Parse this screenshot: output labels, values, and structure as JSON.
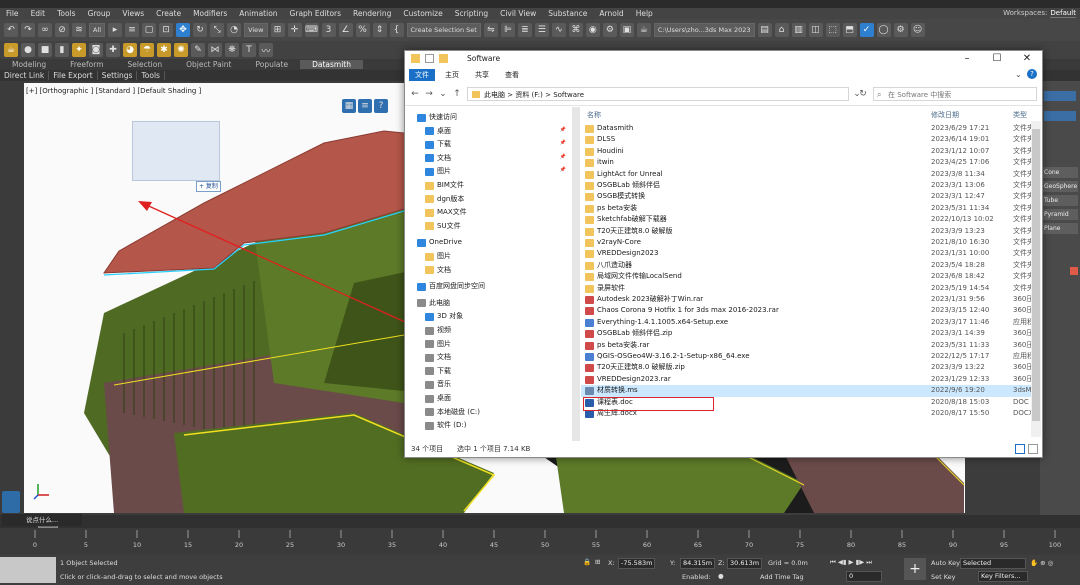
{
  "app": {
    "title": "",
    "menus": [
      "File",
      "Edit",
      "Tools",
      "Group",
      "Views",
      "Create",
      "Modifiers",
      "Animation",
      "Graph Editors",
      "Rendering",
      "Customize",
      "Scripting",
      "Civil View",
      "Substance",
      "Arnold",
      "Help"
    ],
    "workspaces_label": "Workspaces:",
    "workspaces_value": "Default",
    "toolbar": {
      "selection_filter": "All",
      "ref_coord": "View",
      "named_selection": "Create Selection Set",
      "path_field": "C:\\Users\\zho...3ds Max 2023"
    },
    "ribbon_tabs": [
      "Modeling",
      "Freeform",
      "Selection",
      "Object Paint",
      "Populate",
      "Datasmith"
    ],
    "ribbon_active": "Datasmith",
    "sublinks": [
      "Direct Link",
      "File Export",
      "Settings",
      "Tools"
    ],
    "viewport_label": "[+] [Orthographic ] [Standard ] [Default Shading ]",
    "copy_tag": "+ 复制",
    "command_buttons": [
      "Cone",
      "GeoSphere",
      "Tube",
      "Pyramid",
      "Plane"
    ],
    "timeslider": {
      "frame_display": "0",
      "maxscript_hint": "说点什么..."
    },
    "ruler_ticks": [
      "0",
      "5",
      "10",
      "15",
      "20",
      "25",
      "30",
      "35",
      "40",
      "45",
      "50",
      "55",
      "60",
      "65",
      "70",
      "75",
      "80",
      "85",
      "90",
      "95",
      "100"
    ],
    "status": {
      "selected": "1 Object Selected",
      "prompt": "Click or click-and-drag to select and move objects",
      "x_label": "X:",
      "x_value": "-75.583m",
      "y_label": "Y:",
      "y_value": "84.315m",
      "z_label": "Z:",
      "z_value": "30.613m",
      "grid": "Grid = 0.0m",
      "enabled_label": "Enabled:",
      "add_time_tag": "Add Time Tag",
      "auto_key": "Auto Key",
      "set_key": "Set Key",
      "key_mode": "Selected",
      "key_filters": "Key Filters...",
      "frame_field": "0"
    }
  },
  "explorer": {
    "title": "Software",
    "ribbon_tabs": [
      "文件",
      "主页",
      "共享",
      "查看"
    ],
    "breadcrumb": [
      "此电脑",
      "资料 (F:)",
      "Software"
    ],
    "search_placeholder": "在 Software 中搜索",
    "columns": {
      "name": "名称",
      "date": "修改日期",
      "type": "类型"
    },
    "nav": {
      "quick_access": "快速访问",
      "quick_items": [
        "桌面",
        "下载",
        "文档",
        "图片",
        "BIM文件",
        "dgn版本",
        "MAX文件",
        "SU文件"
      ],
      "onedrive": "OneDrive",
      "onedrive_items": [
        "图片",
        "文档"
      ],
      "baidu": "百度网盘同步空间",
      "this_pc": "此电脑",
      "pc_items": [
        "3D 对象",
        "视频",
        "图片",
        "文档",
        "下载",
        "音乐",
        "桌面",
        "本地磁盘 (C:)",
        "软件 (D:)"
      ]
    },
    "files": [
      {
        "name": "Datasmith",
        "date": "2023/6/29 17:21",
        "type": "文件夹",
        "icon": "folder"
      },
      {
        "name": "DLSS",
        "date": "2023/6/14 19:01",
        "type": "文件夹",
        "icon": "folder"
      },
      {
        "name": "Houdini",
        "date": "2023/1/12 10:07",
        "type": "文件夹",
        "icon": "folder"
      },
      {
        "name": "itwin",
        "date": "2023/4/25 17:06",
        "type": "文件夹",
        "icon": "folder"
      },
      {
        "name": "LightAct for Unreal",
        "date": "2023/3/8 11:34",
        "type": "文件夹",
        "icon": "folder"
      },
      {
        "name": "OSGBLab 倾斜伴侣",
        "date": "2023/3/1 13:06",
        "type": "文件夹",
        "icon": "folder"
      },
      {
        "name": "OSGB模式转换",
        "date": "2023/3/1 12:47",
        "type": "文件夹",
        "icon": "folder"
      },
      {
        "name": "ps beta安装",
        "date": "2023/5/31 11:34",
        "type": "文件夹",
        "icon": "folder"
      },
      {
        "name": "Sketchfab破解下载器",
        "date": "2022/10/13 10:02",
        "type": "文件夹",
        "icon": "folder"
      },
      {
        "name": "T20天正建筑8.0 破解版",
        "date": "2023/3/9 13:23",
        "type": "文件夹",
        "icon": "folder"
      },
      {
        "name": "v2rayN-Core",
        "date": "2021/8/10 16:30",
        "type": "文件夹",
        "icon": "folder"
      },
      {
        "name": "VREDDesign2023",
        "date": "2023/1/31 10:00",
        "type": "文件夹",
        "icon": "folder"
      },
      {
        "name": "八爪造动器",
        "date": "2023/5/4 18:28",
        "type": "文件夹",
        "icon": "folder"
      },
      {
        "name": "局域网文件传输LocalSend",
        "date": "2023/6/8 18:42",
        "type": "文件夹",
        "icon": "folder"
      },
      {
        "name": "录屏软件",
        "date": "2023/5/19 14:54",
        "type": "文件夹",
        "icon": "folder"
      },
      {
        "name": "Autodesk 2023破解补丁Win.rar",
        "date": "2023/1/31 9:56",
        "type": "360压",
        "icon": "archive"
      },
      {
        "name": "Chaos Corona 9 Hotfix 1 for 3ds max 2016-2023.rar",
        "date": "2023/3/15 12:40",
        "type": "360压",
        "icon": "archive"
      },
      {
        "name": "Everything-1.4.1.1005.x64-Setup.exe",
        "date": "2023/3/17 11:46",
        "type": "应用程",
        "icon": "exe"
      },
      {
        "name": "OSGBLab 倾斜伴侣.zip",
        "date": "2023/3/1 14:39",
        "type": "360压",
        "icon": "archive"
      },
      {
        "name": "ps beta安装.rar",
        "date": "2023/5/31 11:33",
        "type": "360压",
        "icon": "archive"
      },
      {
        "name": "QGIS-OSGeo4W-3.16.2-1-Setup-x86_64.exe",
        "date": "2022/12/5 17:17",
        "type": "应用程",
        "icon": "exe"
      },
      {
        "name": "T20天正建筑8.0 破解版.zip",
        "date": "2023/3/9 13:22",
        "type": "360压",
        "icon": "archive"
      },
      {
        "name": "VREDDesign2023.rar",
        "date": "2023/1/29 12:33",
        "type": "360压",
        "icon": "archive"
      },
      {
        "name": "材质转换.ms",
        "date": "2022/9/6 19:20",
        "type": "3dsM",
        "icon": "script",
        "selected": true
      },
      {
        "name": "课程表.doc",
        "date": "2020/8/18 15:03",
        "type": "DOC 文",
        "icon": "doc"
      },
      {
        "name": "周生辉.docx",
        "date": "2020/8/17 15:50",
        "type": "DOCX",
        "icon": "doc"
      }
    ],
    "status": {
      "count": "34 个项目",
      "selection": "选中 1 个项目  7.14 KB"
    }
  },
  "colors": {
    "folder": "#f2c55c",
    "archive": "#d14a4a",
    "exe": "#4a7fd1",
    "script": "#6a8ab0",
    "doc": "#2a5caa",
    "selection_red": "#d9262e",
    "roof": "#b5564a",
    "building": "#5b6e25"
  }
}
